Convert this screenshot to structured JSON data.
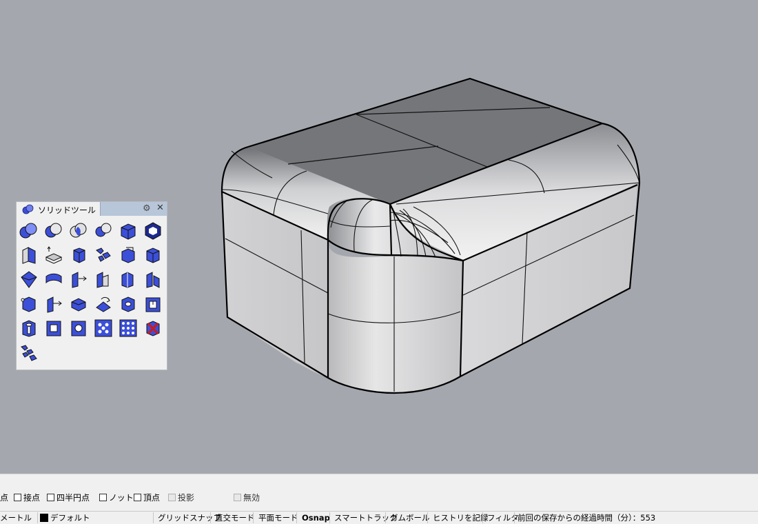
{
  "toolbar_panel": {
    "title": "ソリッドツール",
    "tools": [
      "boolean-union-icon",
      "boolean-difference-icon",
      "boolean-intersection-icon",
      "boolean-split-icon",
      "create-solid-icon",
      "cap-planar-holes-icon",
      "extract-surface-icon",
      "move-face-icon",
      "move-edge-icon",
      "shell-icon",
      "wire-cut-icon",
      "box-solid-icon",
      "solid-shape-icon",
      "offset-surface-icon",
      "move-untrimmed-face-icon",
      "extrude-face-icon",
      "split-face-icon",
      "extrude-edge-icon",
      "fillet-edge-icon",
      "extrude-curve-icon",
      "chamfer-edge-icon",
      "rotate-face-icon",
      "make-hole-icon",
      "place-hole-icon",
      "hole-icon",
      "round-hole-icon",
      "move-hole-icon",
      "array-hole-icon",
      "array-hole-grid-icon",
      "delete-hole-icon",
      "explode-solid-icon"
    ]
  },
  "osnap_bar": {
    "items": [
      {
        "label": "点",
        "checked": false,
        "partial": true
      },
      {
        "label": "接点",
        "checked": false
      },
      {
        "label": "四半円点",
        "checked": false
      },
      {
        "label": "ノット",
        "checked": false
      },
      {
        "label": "頂点",
        "checked": false
      },
      {
        "label": "投影",
        "checked": false,
        "grayed": true
      },
      {
        "label": "無効",
        "checked": false,
        "grayed": true
      }
    ]
  },
  "status_bar": {
    "units": "メートル",
    "layer": "デフォルト",
    "layer_color": "#000000",
    "buttons": [
      "グリッドスナップ",
      "直交モード",
      "平面モード",
      "Osnap",
      "スマートトラック",
      "ガムボール",
      "ヒストリを記録",
      "フィルタ"
    ],
    "active_button": "Osnap",
    "last_save_label": "前回の保存からの経過時間（分）：",
    "last_save_minutes": "553"
  },
  "colors": {
    "viewport_background": "#a4a8ae",
    "panel_background": "#f0f0f0",
    "icon_blue": "#3c4fd8"
  }
}
